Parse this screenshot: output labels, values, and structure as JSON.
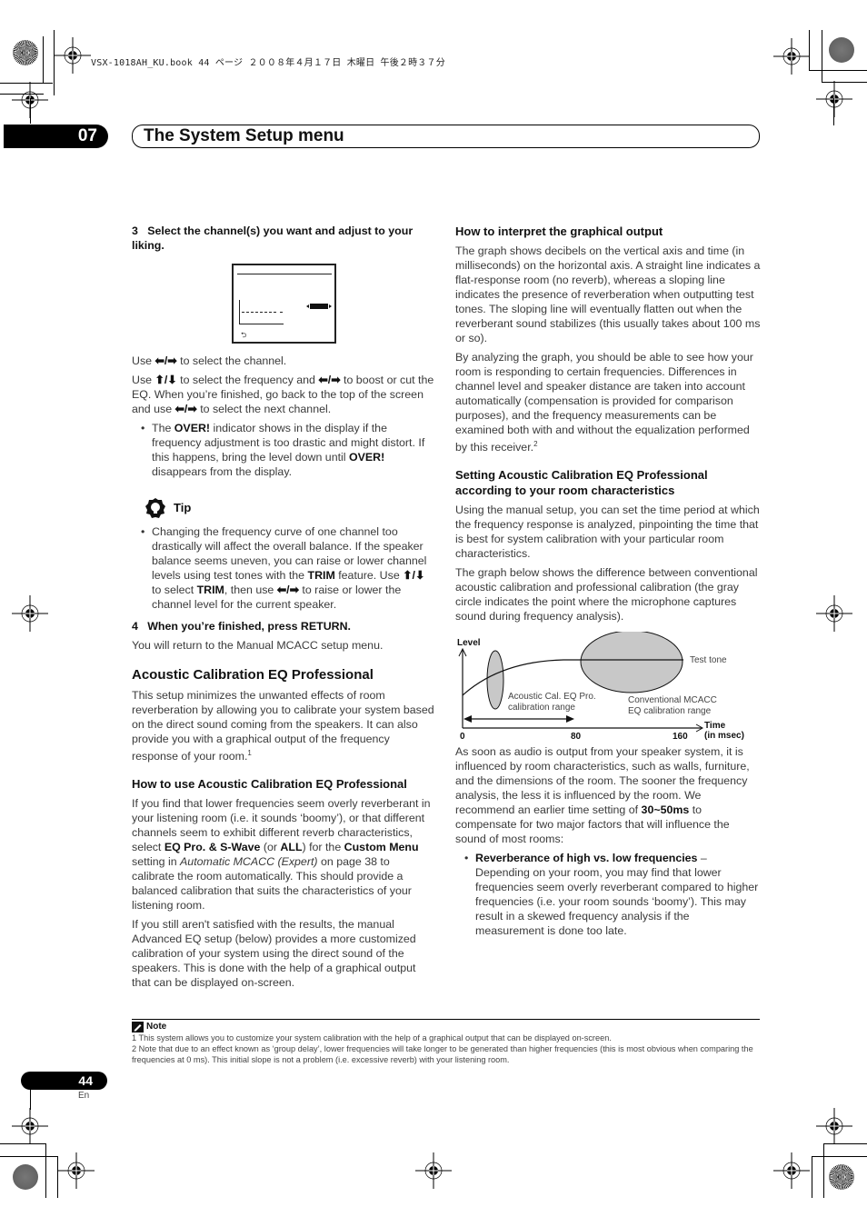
{
  "print_header": "VSX-1018AH_KU.book  44 ページ  ２００８年４月１７日  木曜日  午後２時３７分",
  "chapter": {
    "number": "07",
    "title": "The System Setup menu"
  },
  "left_column": {
    "step3": {
      "number": "3",
      "text": "Select the channel(s) you want and adjust to your liking."
    },
    "eq_screen_icon": "return-icon",
    "instr1": {
      "pre": "Use ",
      "arrows": "⬅/➡",
      "post": " to select the channel."
    },
    "instr2": {
      "pre": "Use ",
      "arrows_ud": "⬆/⬇",
      "mid": " to select the frequency and ",
      "arrows_lr": "⬅/➡",
      "mid2": " to boost or cut the EQ. When you’re finished, go back to the top of the screen and use ",
      "arrows_lr2": "⬅/➡",
      "post": " to select the next channel."
    },
    "over_bullet": {
      "pre": "The ",
      "bold1": "OVER!",
      "mid": " indicator shows in the display if the frequency adjustment is too drastic and might distort. If this happens, bring the level down until ",
      "bold2": "OVER!",
      "post": " disappears from the display."
    },
    "tip": {
      "icon": "lightbulb-icon",
      "label": "Tip",
      "bullet": {
        "pre": "Changing the frequency curve of one channel too drastically will affect the overall balance. If the speaker balance seems uneven, you can raise or lower channel levels using test tones with the ",
        "bold1": "TRIM",
        "mid": " feature. Use ",
        "arrows_ud": "⬆/⬇",
        "mid2": " to select ",
        "bold2": "TRIM",
        "mid3": ", then use ",
        "arrows_lr": "⬅/➡",
        "post": " to raise or lower the channel level for the current speaker."
      }
    },
    "step4": {
      "number": "4",
      "text": "When you’re finished, press RETURN.",
      "desc": "You will return to the Manual MCACC setup menu."
    },
    "section_title": "Acoustic Calibration EQ Professional",
    "section_body": "This setup minimizes the unwanted effects of room reverberation by allowing you to calibrate your system based on the direct sound coming from the speakers. It can also provide you with a graphical output of the frequency response of your room.",
    "section_footnote_ref": "1",
    "howto_title": "How to use Acoustic Calibration EQ Professional",
    "howto_p1": {
      "pre": "If you find that lower frequencies seem overly reverberant in your listening room (i.e. it sounds ‘boomy’), or that different channels seem to exhibit different reverb characteristics, select ",
      "bold1": "EQ Pro. & S-Wave",
      "mid": " (or ",
      "bold2": "ALL",
      "mid2": ") for the ",
      "bold3": "Custom Menu",
      "mid3": " setting in ",
      "italic": "Automatic MCACC (Expert)",
      "post": " on page 38 to calibrate the room automatically. This should provide a balanced calibration that suits the characteristics of your listening room."
    },
    "howto_p2": "If you still aren't satisfied with the results, the manual Advanced EQ setup (below) provides a more customized calibration of your system using the direct sound of the speakers. This is done with the help of a graphical output that can be displayed on-screen."
  },
  "right_column": {
    "interpret_title": "How to interpret the graphical output",
    "interpret_p1": "The graph shows decibels on the vertical axis and time (in milliseconds) on the horizontal axis. A straight line indicates a flat-response room (no reverb), whereas a sloping line indicates the presence of reverberation when outputting test tones. The sloping line will eventually flatten out when the reverberant sound stabilizes (this usually takes about 100 ms or so).",
    "interpret_p2": "By analyzing the graph, you should be able to see how your room is responding to certain frequencies. Differences in channel level and speaker distance are taken into account automatically (compensation is provided for comparison purposes), and the frequency measurements can be examined both with and without the equalization performed by this receiver.",
    "interpret_footnote_ref": "2",
    "setting_title": "Setting Acoustic Calibration EQ Professional according to your room characteristics",
    "setting_p1": "Using the manual setup, you can set the time period at which the frequency response is analyzed, pinpointing the time that is best for system calibration with your particular room characteristics.",
    "setting_p2": "The graph below shows the difference between conventional acoustic calibration and professional calibration (the gray circle indicates the point where the microphone captures sound during frequency analysis).",
    "graph": {
      "y_label": "Level",
      "x_label_line1": "Time",
      "x_label_line2": "(in msec)",
      "ticks": [
        "0",
        "80",
        "160"
      ],
      "test_tone_label": "Test tone",
      "pro_range_label_line1": "Acoustic Cal. EQ Pro.",
      "pro_range_label_line2": "calibration range",
      "conv_range_label_line1": "Conventional MCACC",
      "conv_range_label_line2": "EQ calibration range",
      "ellipse_fill": "#c8c8c8"
    },
    "after_p1": {
      "pre": "As soon as audio is output from your speaker system, it is influenced by room characteristics, such as walls, furniture, and the dimensions of the room. The sooner the frequency analysis, the less it is influenced by the room. We recommend an earlier time setting of ",
      "bold": "30~50ms",
      "post": " to compensate for two major factors that will influence the sound of most rooms:"
    },
    "bullet": {
      "bold": "Reverberance of high vs. low frequencies",
      "dash": " – ",
      "text": "Depending on your room, you may find that lower frequencies seem overly reverberant compared to higher frequencies (i.e. your room sounds ‘boomy’). This may result in a skewed frequency analysis if the measurement is done too late."
    }
  },
  "notes": {
    "icon": "pencil-note-icon",
    "title": "Note",
    "items": [
      "1 This system allows you to customize your system calibration with the help of a graphical output that can be displayed on-screen.",
      "2 Note that due to an effect known as ‘group delay’, lower frequencies will take longer to be generated than higher frequencies (this is most obvious when comparing the frequencies at 0 ms). This initial slope is not a problem (i.e. excessive reverb) with your listening room."
    ]
  },
  "footer": {
    "page_number": "44",
    "language": "En"
  }
}
